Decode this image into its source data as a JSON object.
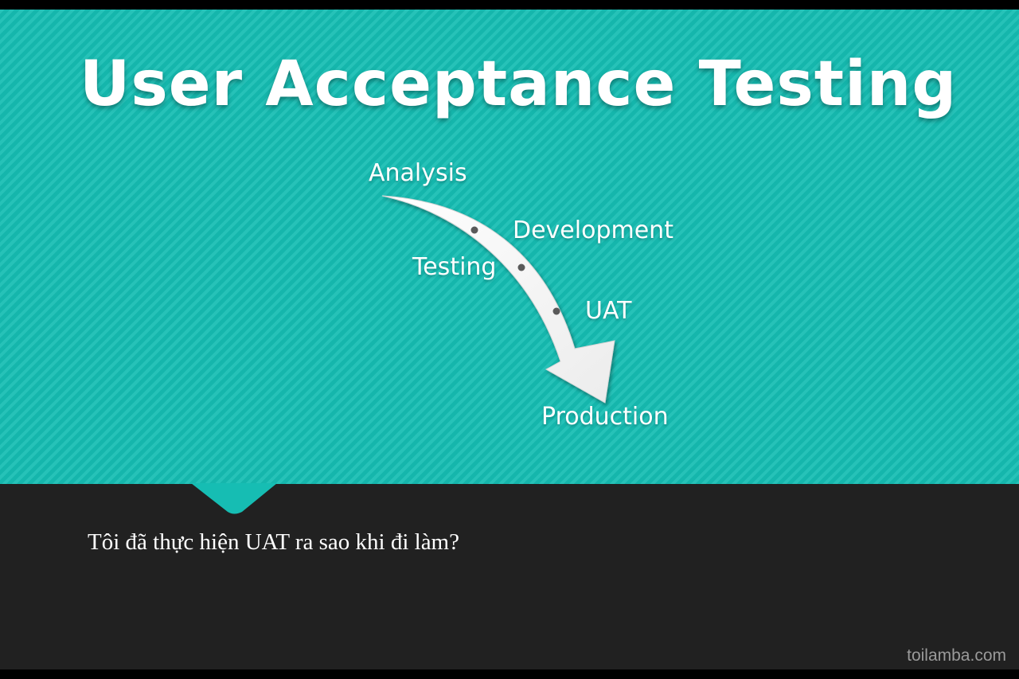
{
  "slide": {
    "title": "User Acceptance Testing",
    "caption": "Tôi đã thực hiện UAT ra sao khi đi làm?",
    "watermark": "toilamba.com"
  },
  "diagram": {
    "stages": [
      {
        "key": "analysis",
        "label": "Analysis"
      },
      {
        "key": "development",
        "label": "Development"
      },
      {
        "key": "testing",
        "label": "Testing"
      },
      {
        "key": "uat",
        "label": "UAT"
      },
      {
        "key": "production",
        "label": "Production"
      }
    ]
  },
  "colors": {
    "teal": "#16bdb3",
    "dark": "#212121",
    "text": "#ffffff",
    "watermark": "#9a9a9a"
  }
}
